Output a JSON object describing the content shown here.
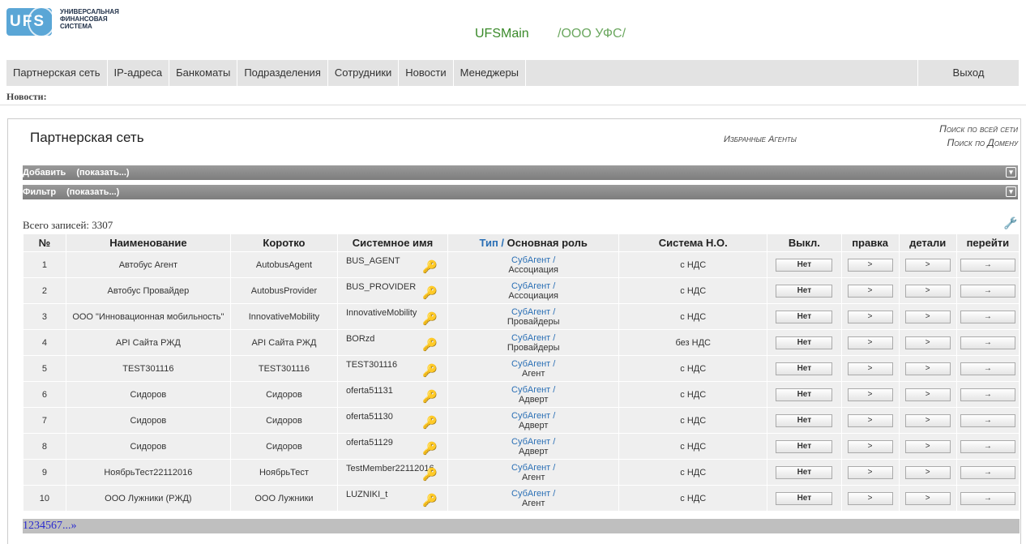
{
  "logo": {
    "badge": "UFS",
    "lines": [
      "УНИВЕРСАЛЬНАЯ",
      "ФИНАНСОВАЯ",
      "СИСТЕМА"
    ]
  },
  "header": {
    "system": "UFSMain",
    "org": "/ООО УФС/"
  },
  "nav": {
    "items": [
      "Партнерская сеть",
      "IP-адреса",
      "Банкоматы",
      "Подразделения",
      "Сотрудники",
      "Новости",
      "Менеджеры"
    ],
    "exit": "Выход"
  },
  "news_label": "Новости:",
  "panel": {
    "title": "Партнерская сеть",
    "fav_agents": "Избранные Агенты",
    "search_all": "Поиск по всей сети",
    "search_domain": "Поиск по Домену"
  },
  "bars": {
    "add_label": "Добавить",
    "add_toggle": "(показать...)",
    "filter_label": "Фильтр",
    "filter_toggle": "(показать...)"
  },
  "records": "Всего записей: 3307",
  "table": {
    "headers": {
      "num": "№",
      "name": "Наименование",
      "short": "Коротко",
      "sysname": "Системное имя",
      "type": "Тип",
      "slash": "/",
      "role": "Основная роль",
      "tax": "Система Н.О.",
      "off": "Выкл.",
      "edit": "правка",
      "details": "детали",
      "go": "перейти"
    },
    "rows": [
      {
        "num": "1",
        "name": "Автобус Агент",
        "short": "AutobusAgent",
        "sys": "BUS_AGENT",
        "type": "СубАгент",
        "role": "Ассоциация",
        "tax": "с НДС",
        "off": "Нет",
        "edit": ">",
        "det": ">",
        "go": "→"
      },
      {
        "num": "2",
        "name": "Автобус Провайдер",
        "short": "AutobusProvider",
        "sys": "BUS_PROVIDER",
        "type": "СубАгент",
        "role": "Ассоциация",
        "tax": "с НДС",
        "off": "Нет",
        "edit": ">",
        "det": ">",
        "go": "→"
      },
      {
        "num": "3",
        "name": "ООО \"Инновационная мобильность\"",
        "short": "InnovativeMobility",
        "sys": "InnovativeMobility",
        "type": "СубАгент",
        "role": "Провайдеры",
        "tax": "с НДС",
        "off": "Нет",
        "edit": ">",
        "det": ">",
        "go": "→"
      },
      {
        "num": "4",
        "name": "API Сайта РЖД",
        "short": "API Сайта РЖД",
        "sys": "BORzd",
        "type": "СубАгент",
        "role": "Провайдеры",
        "tax": "без НДС",
        "off": "Нет",
        "edit": ">",
        "det": ">",
        "go": "→"
      },
      {
        "num": "5",
        "name": "TEST301116",
        "short": "TEST301116",
        "sys": "TEST301116",
        "type": "СубАгент",
        "role": "Агент",
        "tax": "с НДС",
        "off": "Нет",
        "edit": ">",
        "det": ">",
        "go": "→"
      },
      {
        "num": "6",
        "name": "Сидоров",
        "short": "Сидоров",
        "sys": "oferta51131",
        "type": "СубАгент",
        "role": "Адверт",
        "tax": "с НДС",
        "off": "Нет",
        "edit": ">",
        "det": ">",
        "go": "→"
      },
      {
        "num": "7",
        "name": "Сидоров",
        "short": "Сидоров",
        "sys": "oferta51130",
        "type": "СубАгент",
        "role": "Адверт",
        "tax": "с НДС",
        "off": "Нет",
        "edit": ">",
        "det": ">",
        "go": "→"
      },
      {
        "num": "8",
        "name": "Сидоров",
        "short": "Сидоров",
        "sys": "oferta51129",
        "type": "СубАгент",
        "role": "Адверт",
        "tax": "с НДС",
        "off": "Нет",
        "edit": ">",
        "det": ">",
        "go": "→"
      },
      {
        "num": "9",
        "name": "НоябрьТест22112016",
        "short": "НоябрьТест",
        "sys": "TestMember22112016",
        "type": "СубАгент",
        "role": "Агент",
        "tax": "с НДС",
        "off": "Нет",
        "edit": ">",
        "det": ">",
        "go": "→"
      },
      {
        "num": "10",
        "name": "ООО Лужники (РЖД)",
        "short": "ООО Лужники",
        "sys": "LUZNIKI_t",
        "type": "СубАгент",
        "role": "Агент",
        "tax": "с НДС",
        "off": "Нет",
        "edit": ">",
        "det": ">",
        "go": "→"
      }
    ]
  },
  "pager": {
    "pages": [
      "1",
      "2",
      "3",
      "4",
      "5",
      "6",
      "7"
    ],
    "more": "...»"
  },
  "icons": {
    "key": "key-icon",
    "wrench": "wrench-icon",
    "chevron": "double-chevron-down-icon"
  }
}
